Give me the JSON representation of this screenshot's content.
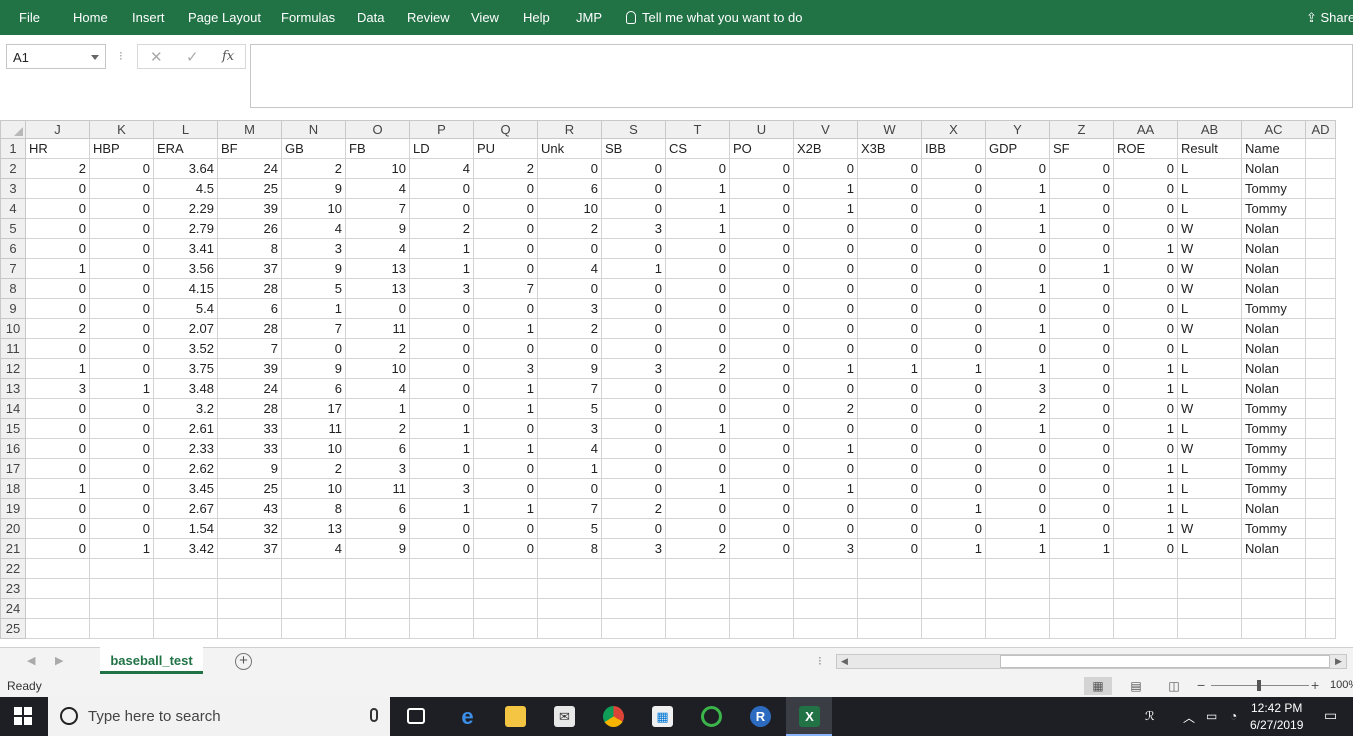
{
  "ribbon": {
    "tabs": [
      "File",
      "Home",
      "Insert",
      "Page Layout",
      "Formulas",
      "Data",
      "Review",
      "View",
      "Help",
      "JMP"
    ],
    "tell_me": "Tell me what you want to do",
    "share": "Share"
  },
  "formula_bar": {
    "name_box": "A1",
    "cancel_glyph": "✕",
    "enter_glyph": "✓",
    "fx_glyph": "fx",
    "content": ""
  },
  "grid": {
    "column_letters": [
      "J",
      "K",
      "L",
      "M",
      "N",
      "O",
      "P",
      "Q",
      "R",
      "S",
      "T",
      "U",
      "V",
      "W",
      "X",
      "Y",
      "Z",
      "AA",
      "AB",
      "AC",
      "AD"
    ],
    "headers": [
      "HR",
      "HBP",
      "ERA",
      "BF",
      "GB",
      "FB",
      "LD",
      "PU",
      "Unk",
      "SB",
      "CS",
      "PO",
      "X2B",
      "X3B",
      "IBB",
      "GDP",
      "SF",
      "ROE",
      "Result",
      "Name",
      ""
    ],
    "rows": [
      [
        "2",
        "0",
        "3.64",
        "24",
        "2",
        "10",
        "4",
        "2",
        "0",
        "0",
        "0",
        "0",
        "0",
        "0",
        "0",
        "0",
        "0",
        "0",
        "L",
        "Nolan"
      ],
      [
        "0",
        "0",
        "4.5",
        "25",
        "9",
        "4",
        "0",
        "0",
        "6",
        "0",
        "1",
        "0",
        "1",
        "0",
        "0",
        "1",
        "0",
        "0",
        "L",
        "Tommy"
      ],
      [
        "0",
        "0",
        "2.29",
        "39",
        "10",
        "7",
        "0",
        "0",
        "10",
        "0",
        "1",
        "0",
        "1",
        "0",
        "0",
        "1",
        "0",
        "0",
        "L",
        "Tommy"
      ],
      [
        "0",
        "0",
        "2.79",
        "26",
        "4",
        "9",
        "2",
        "0",
        "2",
        "3",
        "1",
        "0",
        "0",
        "0",
        "0",
        "1",
        "0",
        "0",
        "W",
        "Nolan"
      ],
      [
        "0",
        "0",
        "3.41",
        "8",
        "3",
        "4",
        "1",
        "0",
        "0",
        "0",
        "0",
        "0",
        "0",
        "0",
        "0",
        "0",
        "0",
        "1",
        "W",
        "Nolan"
      ],
      [
        "1",
        "0",
        "3.56",
        "37",
        "9",
        "13",
        "1",
        "0",
        "4",
        "1",
        "0",
        "0",
        "0",
        "0",
        "0",
        "0",
        "1",
        "0",
        "W",
        "Nolan"
      ],
      [
        "0",
        "0",
        "4.15",
        "28",
        "5",
        "13",
        "3",
        "7",
        "0",
        "0",
        "0",
        "0",
        "0",
        "0",
        "0",
        "1",
        "0",
        "0",
        "W",
        "Nolan"
      ],
      [
        "0",
        "0",
        "5.4",
        "6",
        "1",
        "0",
        "0",
        "0",
        "3",
        "0",
        "0",
        "0",
        "0",
        "0",
        "0",
        "0",
        "0",
        "0",
        "L",
        "Tommy"
      ],
      [
        "2",
        "0",
        "2.07",
        "28",
        "7",
        "11",
        "0",
        "1",
        "2",
        "0",
        "0",
        "0",
        "0",
        "0",
        "0",
        "1",
        "0",
        "0",
        "W",
        "Nolan"
      ],
      [
        "0",
        "0",
        "3.52",
        "7",
        "0",
        "2",
        "0",
        "0",
        "0",
        "0",
        "0",
        "0",
        "0",
        "0",
        "0",
        "0",
        "0",
        "0",
        "L",
        "Nolan"
      ],
      [
        "1",
        "0",
        "3.75",
        "39",
        "9",
        "10",
        "0",
        "3",
        "9",
        "3",
        "2",
        "0",
        "1",
        "1",
        "1",
        "1",
        "0",
        "1",
        "L",
        "Nolan"
      ],
      [
        "3",
        "1",
        "3.48",
        "24",
        "6",
        "4",
        "0",
        "1",
        "7",
        "0",
        "0",
        "0",
        "0",
        "0",
        "0",
        "3",
        "0",
        "1",
        "L",
        "Nolan"
      ],
      [
        "0",
        "0",
        "3.2",
        "28",
        "17",
        "1",
        "0",
        "1",
        "5",
        "0",
        "0",
        "0",
        "2",
        "0",
        "0",
        "2",
        "0",
        "0",
        "W",
        "Tommy"
      ],
      [
        "0",
        "0",
        "2.61",
        "33",
        "11",
        "2",
        "1",
        "0",
        "3",
        "0",
        "1",
        "0",
        "0",
        "0",
        "0",
        "1",
        "0",
        "1",
        "L",
        "Tommy"
      ],
      [
        "0",
        "0",
        "2.33",
        "33",
        "10",
        "6",
        "1",
        "1",
        "4",
        "0",
        "0",
        "0",
        "1",
        "0",
        "0",
        "0",
        "0",
        "0",
        "W",
        "Tommy"
      ],
      [
        "0",
        "0",
        "2.62",
        "9",
        "2",
        "3",
        "0",
        "0",
        "1",
        "0",
        "0",
        "0",
        "0",
        "0",
        "0",
        "0",
        "0",
        "1",
        "L",
        "Tommy"
      ],
      [
        "1",
        "0",
        "3.45",
        "25",
        "10",
        "11",
        "3",
        "0",
        "0",
        "0",
        "1",
        "0",
        "1",
        "0",
        "0",
        "0",
        "0",
        "1",
        "L",
        "Tommy"
      ],
      [
        "0",
        "0",
        "2.67",
        "43",
        "8",
        "6",
        "1",
        "1",
        "7",
        "2",
        "0",
        "0",
        "0",
        "0",
        "1",
        "0",
        "0",
        "1",
        "L",
        "Nolan"
      ],
      [
        "0",
        "0",
        "1.54",
        "32",
        "13",
        "9",
        "0",
        "0",
        "5",
        "0",
        "0",
        "0",
        "0",
        "0",
        "0",
        "1",
        "0",
        "1",
        "W",
        "Tommy"
      ],
      [
        "0",
        "1",
        "3.42",
        "37",
        "4",
        "9",
        "0",
        "0",
        "8",
        "3",
        "2",
        "0",
        "3",
        "0",
        "1",
        "1",
        "1",
        "0",
        "L",
        "Nolan"
      ]
    ],
    "empty_row_numbers": [
      "22",
      "23",
      "24",
      "25"
    ]
  },
  "sheet_tabs": {
    "active": "baseball_test",
    "add_glyph": "+"
  },
  "status_bar": {
    "status": "Ready",
    "zoom": "100%"
  },
  "taskbar": {
    "search_placeholder": "Type here to search",
    "apps": [
      "task-view",
      "edge",
      "file-explorer",
      "mail",
      "chrome",
      "store",
      "circular-app",
      "r",
      "excel"
    ],
    "time": "12:42 PM",
    "date": "6/27/2019"
  },
  "colors": {
    "excel_green": "#217346",
    "taskbar": "#1d1f24"
  }
}
